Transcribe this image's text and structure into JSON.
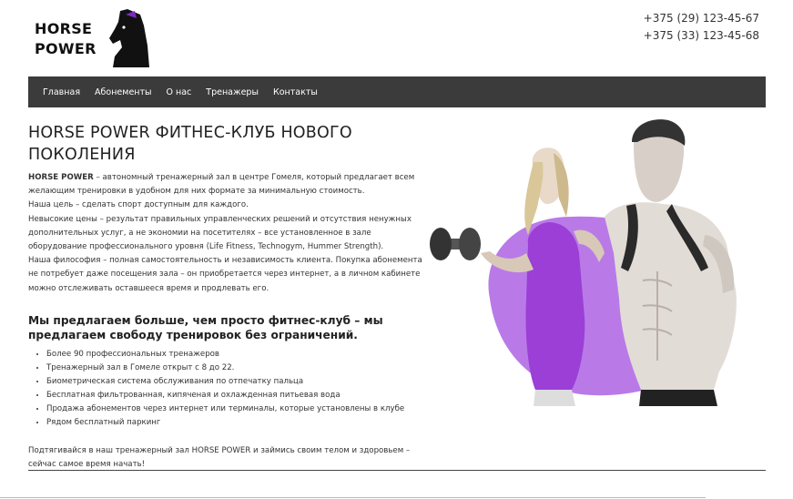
{
  "header": {
    "logo_line1": "HORSE",
    "logo_line2": "POWER",
    "phones": [
      "+375 (29) 123-45-67",
      "+375 (33) 123-45-68"
    ]
  },
  "nav": {
    "items": [
      "Главная",
      "Абонементы",
      "О нас",
      "Тренажеры",
      "Контакты"
    ]
  },
  "main": {
    "title": "HORSE POWER ФИТНЕС-КЛУБ НОВОГО ПОКОЛЕНИЯ",
    "intro_brand": "HORSE POWER",
    "intro_lines": [
      " – автономный тренажерный зал в центре Гомеля, который предлагает всем",
      "желающим тренировки в удобном для них формате за минимальную стоимость.",
      "Наша цель – сделать спорт доступным для каждого.",
      "Невысокие цены – результат правильных управленческих решений и отсутствия ненужных",
      "дополнительных услуг, а не экономии на посетителях – все установленное в зале",
      "оборудование профессионального уровня (Life Fitness, Technogym, Hummer Strength).",
      "Наша философия – полная самостоятельность и независимость клиента. Покупка абонемента",
      "не потребует даже посещения зала – он приобретается через интернет, а в личном кабинете",
      "можно отслеживать оставшееся время и продлевать его."
    ],
    "subtitle": "Мы предлагаем больше, чем просто фитнес-клуб – мы предлагаем свободу тренировок без ограничений.",
    "features": [
      "Более 90 профессиональных тренажеров",
      "Тренажерный зал в Гомеле открыт с 8 до 22.",
      "Биометрическая система обслуживания по отпечатку пальца",
      "Бесплатная фильтрованная, кипяченая и охлажденная питьевая вода",
      "Продажа абонементов через интернет или терминалы, которые установлены в клубе",
      "Рядом бесплатный паркинг"
    ],
    "closing": "Подтягивайся в наш тренажерный зал HORSE POWER и займись своим телом и здоровьем – сейчас самое время начать!"
  },
  "colors": {
    "nav_bg": "#3b3b3b",
    "accent_purple": "#b97ae8",
    "tank_purple": "#9b3fd6"
  }
}
